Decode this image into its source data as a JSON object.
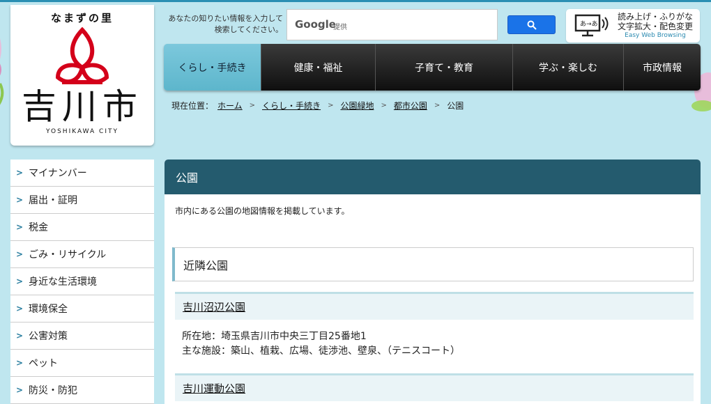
{
  "logo": {
    "kana": "なまずの里",
    "kanji": "吉川市",
    "roman": "YOSHIKAWA CITY"
  },
  "search": {
    "label_line1": "あなたの知りたい情報を入力して",
    "label_line2": "検索してください。",
    "brand": "Google",
    "provided": "提供",
    "button_icon": "search-icon"
  },
  "ewb": {
    "line1": "読み上げ・ふりがな",
    "line2": "文字拡大・配色変更",
    "line3": "Easy Web Browsing"
  },
  "nav": {
    "items": [
      {
        "label": "くらし・手続き"
      },
      {
        "label": "健康・福祉"
      },
      {
        "label": "子育て・教育"
      },
      {
        "label": "学ぶ・楽しむ"
      },
      {
        "label": "市政情報"
      }
    ]
  },
  "breadcrumb": {
    "prefix": "現在位置：",
    "items": [
      "ホーム",
      "くらし・手続き",
      "公園緑地",
      "都市公園"
    ],
    "current": "公園"
  },
  "side": {
    "items": [
      "マイナンバー",
      "届出・証明",
      "税金",
      "ごみ・リサイクル",
      "身近な生活環境",
      "環境保全",
      "公害対策",
      "ペット",
      "防災・防犯"
    ]
  },
  "content": {
    "title": "公園",
    "description": "市内にある公園の地図情報を掲載しています。",
    "section_title": "近隣公園",
    "parks": [
      {
        "name": "吉川沼辺公園",
        "address": "所在地：埼玉県吉川市中央三丁目25番地1",
        "facilities": "主な施設：築山、植栽、広場、徒渉池、壁泉、（テニスコート）"
      },
      {
        "name": "吉川運動公園"
      }
    ]
  },
  "colors": {
    "header_bg": "#245b6e",
    "nav_active": "#6cc0d4",
    "page_bg": "#bfe6ef",
    "logo_red": "#d4001a"
  }
}
